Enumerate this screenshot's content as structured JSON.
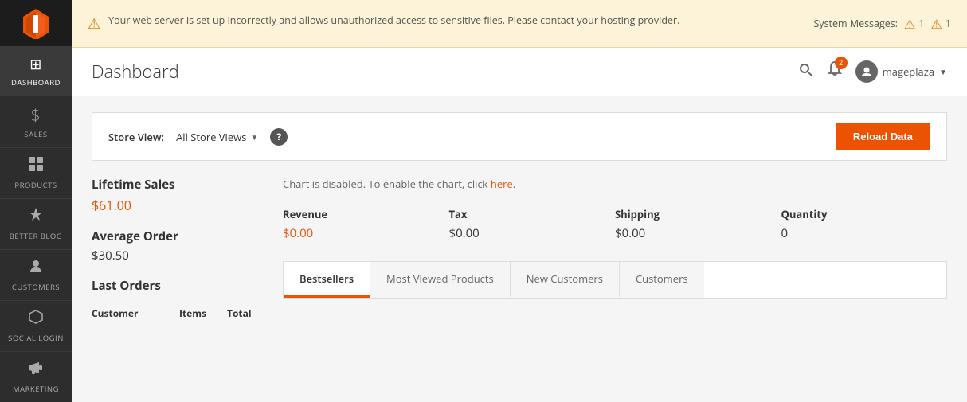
{
  "sidebar": {
    "logo_alt": "Magento Logo",
    "items": [
      {
        "id": "dashboard",
        "label": "DASHBOARD",
        "icon": "⊞",
        "active": true
      },
      {
        "id": "sales",
        "label": "SALES",
        "icon": "$"
      },
      {
        "id": "products",
        "label": "PRODUCTS",
        "icon": "◈"
      },
      {
        "id": "better-blog",
        "label": "BETTER BLOG",
        "icon": "✦"
      },
      {
        "id": "customers",
        "label": "CUSTOMERS",
        "icon": "♟"
      },
      {
        "id": "social-login",
        "label": "SOCIAL LOGIN",
        "icon": "⬡"
      },
      {
        "id": "marketing",
        "label": "MARKETING",
        "icon": "📢"
      }
    ]
  },
  "warning": {
    "message": "Your web server is set up incorrectly and allows unauthorized access to sensitive files. Please contact your hosting provider.",
    "system_messages_label": "System Messages:",
    "alert_count_1": "1",
    "alert_count_2": "1"
  },
  "header": {
    "title": "Dashboard",
    "user_name": "mageplaza",
    "notification_count": "2"
  },
  "store_view": {
    "label": "Store View:",
    "selected": "All Store Views",
    "reload_label": "Reload Data"
  },
  "dashboard": {
    "lifetime_sales_label": "Lifetime Sales",
    "lifetime_sales_value": "$61.00",
    "avg_order_label": "Average Order",
    "avg_order_value": "$30.50",
    "last_orders_label": "Last Orders",
    "col_customer": "Customer",
    "col_items": "Items",
    "col_total": "Total",
    "chart_disabled_msg": "Chart is disabled. To enable the chart, click",
    "chart_link": "here.",
    "stats": {
      "revenue_label": "Revenue",
      "revenue_value": "$0.00",
      "tax_label": "Tax",
      "tax_value": "$0.00",
      "shipping_label": "Shipping",
      "shipping_value": "$0.00",
      "quantity_label": "Quantity",
      "quantity_value": "0"
    },
    "tabs": [
      {
        "id": "bestsellers",
        "label": "Bestsellers",
        "active": true
      },
      {
        "id": "most-viewed",
        "label": "Most Viewed Products",
        "active": false
      },
      {
        "id": "new-customers",
        "label": "New Customers",
        "active": false
      },
      {
        "id": "customers",
        "label": "Customers",
        "active": false
      }
    ]
  },
  "colors": {
    "accent": "#eb5202",
    "sidebar_bg": "#2d2d2d",
    "warning_bg": "#fdf3d8"
  }
}
